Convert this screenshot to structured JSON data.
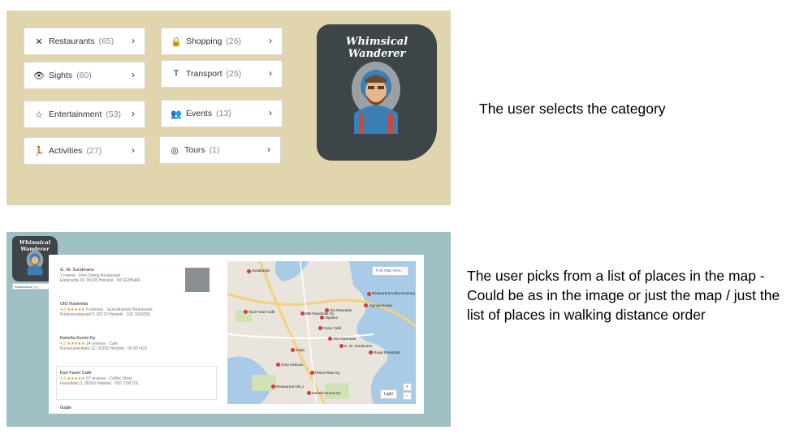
{
  "categories": [
    {
      "label": "Restaurants",
      "count": "(65)",
      "icon": "cutlery-icon",
      "glyph": "✕"
    },
    {
      "label": "Shopping",
      "count": "(26)",
      "icon": "shopping-bag-icon",
      "glyph": "🔒"
    },
    {
      "label": "Sights",
      "count": "(60)",
      "icon": "eye-icon",
      "glyph": "👁"
    },
    {
      "label": "Transport",
      "count": "(25)",
      "icon": "transport-icon",
      "glyph": "T"
    },
    {
      "label": "Entertainment",
      "count": "(53)",
      "icon": "star-icon",
      "glyph": "☆"
    },
    {
      "label": "Events",
      "count": "(13)",
      "icon": "people-icon",
      "glyph": "👥"
    },
    {
      "label": "Activities",
      "count": "(27)",
      "icon": "running-icon",
      "glyph": "🏃"
    },
    {
      "label": "Tours",
      "count": "(1)",
      "icon": "compass-icon",
      "glyph": "◎"
    }
  ],
  "chevron": "›",
  "brand": "Whimsical Wanderer",
  "caption_top": "The user selects the category",
  "caption_bottom": "The user picks from a list of places in the map - Could be as in the image or just the map / just the list of places in walking distance order",
  "mini_category": {
    "label": "Restaurants",
    "count": "(65)"
  },
  "places": [
    {
      "name": "G. W. Sundmans",
      "line2": "1 review · Fine Dining Restaurant",
      "line3": "Eteläranta 16, 00130 Helsinki · 09 61285400"
    },
    {
      "name": "OlO Ravintola",
      "rating": "4.3 ★★★★★",
      "line2": "6 reviews · Scandinavian Restaurant",
      "line3": "Pohjoisesplanadi 5, 00170 Helsinki · 010 3206250"
    },
    {
      "name": "Kahvila-Suomi Ky",
      "rating": "4.3 ★★★★★",
      "line2": "24 reviews · Cafe",
      "line3": "Punavuorenkatu 12, 00150 Helsinki · 09 657422"
    },
    {
      "name": "Karl Fazer Café",
      "rating": "4.3 ★★★★★",
      "line2": "57 reviews · Coffee Shop",
      "line3": "Kluuvikatu 3, 00100 Helsinki · 020 7296702"
    },
    {
      "name": "Gaijin",
      "line2": "",
      "line3": ""
    }
  ],
  "map": {
    "full_view": "Full map view",
    "light_label": "Light",
    "zoom_in": "+",
    "zoom_out": "−",
    "labels": [
      "Sveaborgin",
      "Restaurant Kotka Kruunua",
      "Kynea House",
      "Olo Ravintola",
      "Fazer Café",
      "Vapiano",
      "Karl Fazer Café",
      "OlO Ravintola",
      "G. W. Sundmans",
      "Royal Ravintolat",
      "Gaijin",
      "Gran Delicato",
      "Pela's Plats Oy",
      "Restaurant Aila 1",
      "Kahvila-Suomi Ky",
      "BW Ravintolat Oy"
    ]
  }
}
